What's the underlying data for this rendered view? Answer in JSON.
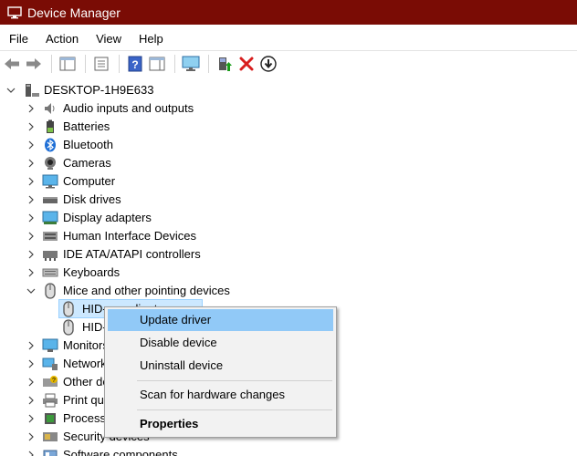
{
  "window": {
    "title": "Device Manager",
    "icon": "device-manager-icon"
  },
  "menu": [
    "File",
    "Action",
    "View",
    "Help"
  ],
  "toolbar": [
    {
      "name": "back-button",
      "icon": "arrow-left-icon"
    },
    {
      "name": "forward-button",
      "icon": "arrow-right-icon"
    },
    {
      "name": "show-hide-console-tree-button",
      "icon": "console-tree-icon"
    },
    {
      "name": "properties-button",
      "icon": "properties-icon"
    },
    {
      "name": "help-button",
      "icon": "help-icon"
    },
    {
      "name": "show-action-pane-button",
      "icon": "action-pane-icon"
    },
    {
      "name": "scan-hardware-button",
      "icon": "monitor-scan-icon"
    },
    {
      "name": "update-driver-button",
      "icon": "update-driver-icon"
    },
    {
      "name": "uninstall-device-button",
      "icon": "red-x-icon"
    },
    {
      "name": "disable-device-button",
      "icon": "down-arrow-circle-icon"
    }
  ],
  "tree": {
    "root": "DESKTOP-1H9E633",
    "categories": [
      {
        "label": "Audio inputs and outputs",
        "icon": "speaker-icon"
      },
      {
        "label": "Batteries",
        "icon": "battery-icon"
      },
      {
        "label": "Bluetooth",
        "icon": "bluetooth-icon"
      },
      {
        "label": "Cameras",
        "icon": "camera-icon"
      },
      {
        "label": "Computer",
        "icon": "computer-icon"
      },
      {
        "label": "Disk drives",
        "icon": "disk-drive-icon"
      },
      {
        "label": "Display adapters",
        "icon": "display-adapter-icon"
      },
      {
        "label": "Human Interface Devices",
        "icon": "hid-icon"
      },
      {
        "label": "IDE ATA/ATAPI controllers",
        "icon": "ide-controller-icon"
      },
      {
        "label": "Keyboards",
        "icon": "keyboard-icon"
      },
      {
        "label": "Mice and other pointing devices",
        "icon": "mouse-icon",
        "expanded": true
      },
      {
        "label": "HID-compliant mouse",
        "icon": "mouse-icon",
        "child": true,
        "selected": true
      },
      {
        "label": "HID-compliant mouse",
        "icon": "mouse-icon",
        "child": true
      },
      {
        "label": "Monitors",
        "icon": "monitor-icon"
      },
      {
        "label": "Network adapters",
        "icon": "network-adapter-icon"
      },
      {
        "label": "Other devices",
        "icon": "other-devices-icon"
      },
      {
        "label": "Print queues",
        "icon": "printer-icon"
      },
      {
        "label": "Processors",
        "icon": "processor-icon"
      },
      {
        "label": "Security devices",
        "icon": "security-device-icon"
      },
      {
        "label": "Software components",
        "icon": "software-component-icon"
      }
    ]
  },
  "context_menu": {
    "items": [
      {
        "label": "Update driver",
        "active": true
      },
      {
        "label": "Disable device"
      },
      {
        "label": "Uninstall device"
      },
      {
        "label": "Scan for hardware changes"
      },
      {
        "label": "Properties",
        "bold": true
      }
    ]
  },
  "colors": {
    "titlebar": "#7a0c05",
    "menu_highlight": "#91c9f7",
    "selection": "#cce8ff"
  }
}
